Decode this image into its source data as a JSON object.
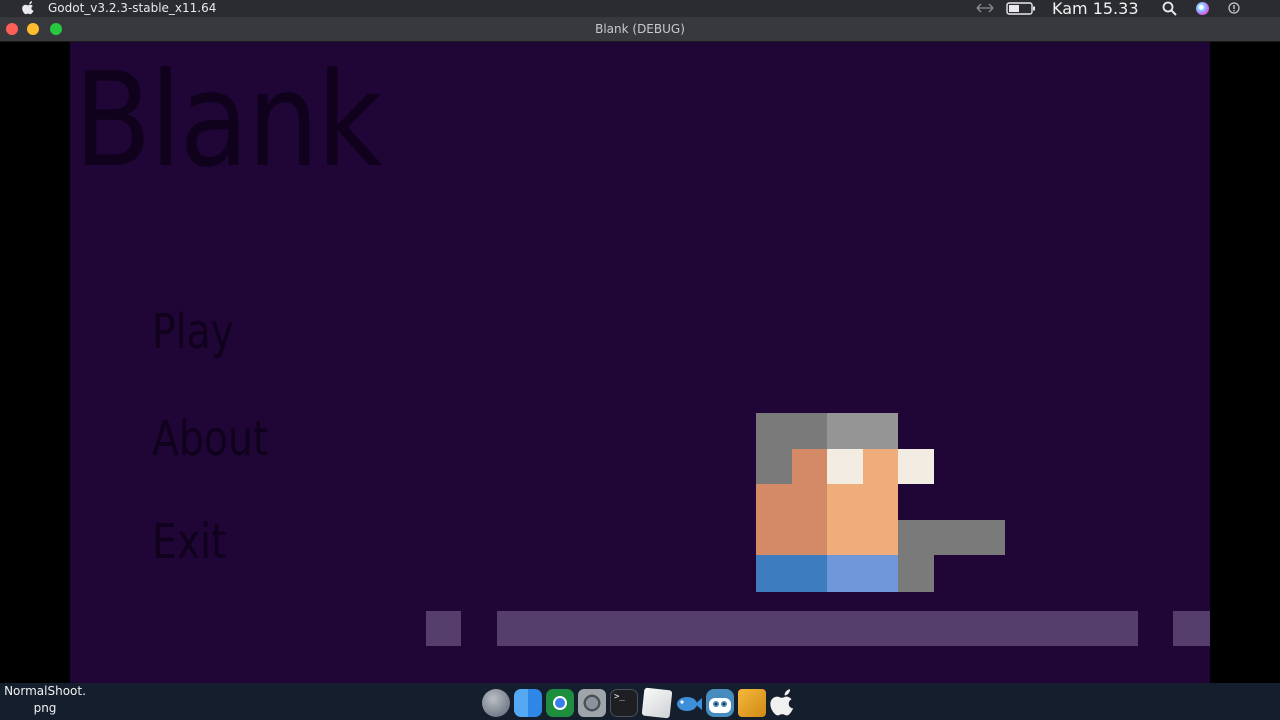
{
  "menubar": {
    "app_name": "Godot_v3.2.3-stable_x11.64",
    "clock": "Kam 15.33",
    "icons": [
      "apple-icon",
      "arrows-icon",
      "battery-icon",
      "search-icon",
      "siri-icon",
      "notification-icon"
    ]
  },
  "window": {
    "title": "Blank (DEBUG)",
    "controls": [
      "close",
      "minimize",
      "maximize"
    ]
  },
  "game": {
    "title": "Blank",
    "menu": {
      "play": "Play",
      "about": "About",
      "exit": "Exit"
    },
    "colors": {
      "background": "#1f0637",
      "title_text": "#10021c",
      "platform": "#553e6b"
    }
  },
  "dock": {
    "file_label_line1": "NormalShoot.",
    "file_label_line2": "png",
    "apps": [
      "launchpad-icon",
      "finder-icon",
      "chrome-icon",
      "system-preferences-icon",
      "terminal-icon",
      "text-editor-icon",
      "fish-icon",
      "godot-icon",
      "sublime-icon",
      "apple-icon"
    ]
  }
}
